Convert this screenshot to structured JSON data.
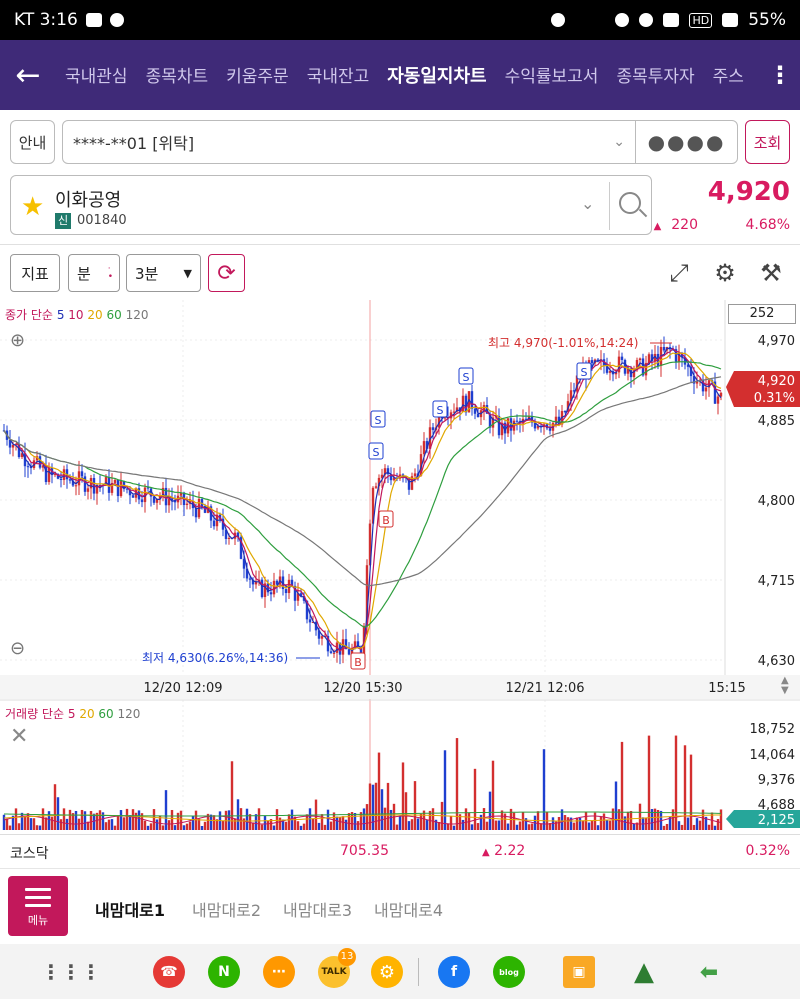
{
  "status_bar": {
    "carrier_time": "KT 3:16",
    "battery": "55%",
    "net": "HD"
  },
  "nav": {
    "tabs": [
      {
        "label": "국내관심",
        "badge": false
      },
      {
        "label": "종목차트",
        "badge": true
      },
      {
        "label": "키움주문",
        "badge": true
      },
      {
        "label": "국내잔고",
        "badge": true
      },
      {
        "label": "자동일지차트",
        "badge": false,
        "active": true
      },
      {
        "label": "수익률보고서",
        "badge": false
      },
      {
        "label": "종목투자자",
        "badge": false
      },
      {
        "label": "주스",
        "badge": false
      }
    ]
  },
  "account": {
    "guide_label": "안내",
    "number": "****-**01 [위탁]",
    "password_mask": "●●●●",
    "query_label": "조회"
  },
  "stock": {
    "name": "이화공영",
    "market_badge": "신",
    "code": "001840",
    "price": "4,920",
    "change": "220",
    "change_pct": "4.68%"
  },
  "toolbar": {
    "indicator_label": "지표",
    "unit_label": "분",
    "interval_label": "3분"
  },
  "chart_legend": {
    "price_prefix": "종가 단순",
    "ma": [
      "5",
      "10",
      "20",
      "60",
      "120"
    ],
    "volume_prefix": "거래량 단순",
    "vol_ma": [
      "5",
      "20",
      "60",
      "120"
    ],
    "count_box": "252"
  },
  "chart_data": [
    {
      "type": "candlestick",
      "y_ticks": [
        "4,970",
        "4,885",
        "4,800",
        "4,715",
        "4,630"
      ],
      "ylim": [
        4630,
        4970
      ],
      "x_ticks": [
        "12/20 12:09",
        "12/20 15:30",
        "12/21 12:06",
        "15:15"
      ],
      "current_price": "4,920",
      "current_pct": "0.31%",
      "annotations": {
        "high": "최고 4,970(-1.01%,14:24)",
        "low": "최저 4,630(6.26%,14:36)"
      },
      "signals": [
        "S",
        "S",
        "B",
        "S",
        "S",
        "S",
        "B"
      ],
      "series": [
        {
          "name": "5",
          "color": "#1f2fb5"
        },
        {
          "name": "10",
          "color": "#c2185b"
        },
        {
          "name": "20",
          "color": "#e0a800"
        },
        {
          "name": "60",
          "color": "#2e9e3e"
        },
        {
          "name": "120",
          "color": "#777777"
        }
      ]
    },
    {
      "type": "bar",
      "y_ticks": [
        "18,752",
        "14,064",
        "9,376",
        "4,688"
      ],
      "current_volume": "2,125"
    }
  ],
  "kosdaq": {
    "label": "코스닥",
    "value": "705.35",
    "change": "2.22",
    "change_pct": "0.32%"
  },
  "bottom_menu": {
    "menu_label": "메뉴",
    "tabs": [
      "내맘대로1",
      "내맘대로2",
      "내맘대로3",
      "내맘대로4"
    ]
  },
  "dock": {
    "talk_badge": "13"
  }
}
